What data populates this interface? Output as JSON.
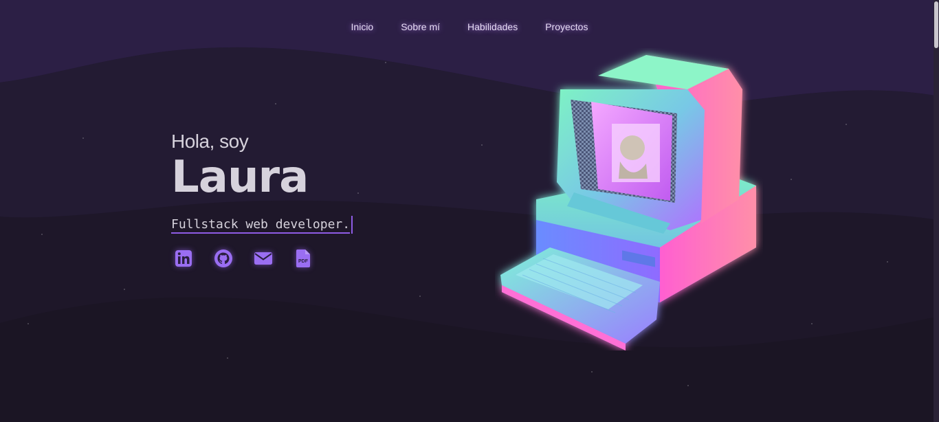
{
  "nav": {
    "items": [
      {
        "label": "Inicio"
      },
      {
        "label": "Sobre mí"
      },
      {
        "label": "Habilidades"
      },
      {
        "label": "Proyectos"
      }
    ]
  },
  "hero": {
    "greeting": "Hola, soy",
    "name": "Laura",
    "role": "Fullstack web developer."
  },
  "socials": [
    {
      "icon": "linkedin-icon"
    },
    {
      "icon": "github-icon"
    },
    {
      "icon": "mail-icon"
    },
    {
      "icon": "pdf-icon",
      "label": "PDF"
    }
  ],
  "colors": {
    "background": "#1d1729",
    "accent": "#8f5ce6",
    "text": "#d6d2dc"
  }
}
